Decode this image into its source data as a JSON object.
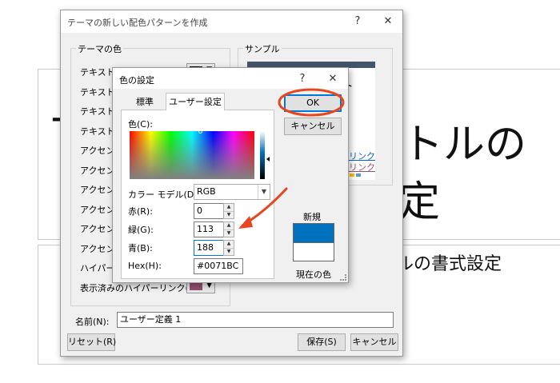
{
  "slide": {
    "title_fragment": "トルの",
    "subtitle_fragment_1": "定",
    "subtitle_fragment_2": "ルの書式設定",
    "left_fragment": "T"
  },
  "main_dialog": {
    "title": "テーマの新しい配色パターンを作成",
    "help": "?",
    "close": "✕",
    "theme_colors_group": "テーマの色",
    "sample_group": "サンプル",
    "rows": [
      {
        "label": "テキスト/背景 - 濃色 1(T)",
        "color": "#000000"
      },
      {
        "label": "テキスト/背景 - 淡色 1(B)",
        "color": "#ffffff"
      },
      {
        "label": "テキスト/背景 - 濃色 2(D)",
        "color": "#44546a"
      },
      {
        "label": "テキスト/背景 - 淡色 2(L)",
        "color": "#e7e6e6"
      },
      {
        "label": "アクセント 1(1)",
        "color": "#4472c4"
      },
      {
        "label": "アクセント 2(2)",
        "color": "#ed7d31"
      },
      {
        "label": "アクセント 3(3)",
        "color": "#a5a5a5"
      },
      {
        "label": "アクセント 4(4)",
        "color": "#ffc000"
      },
      {
        "label": "アクセント 5(5)",
        "color": "#5b9bd5"
      },
      {
        "label": "アクセント 6(6)",
        "color": "#70ad47"
      },
      {
        "label": "ハイパーリンク(H)",
        "color": "#0563c1"
      },
      {
        "label": "表示済みのハイパーリンク(F)",
        "color": "#954f72"
      }
    ],
    "sample_text": "スト",
    "sample_link1": "ーリンク",
    "sample_link2": "ーリンク",
    "name_label": "名前(N):",
    "name_value": "ユーザー定義 1",
    "reset_button": "リセット(R)",
    "save_button": "保存(S)",
    "cancel_button": "キャンセル"
  },
  "color_dialog": {
    "title": "色の設定",
    "help": "?",
    "close": "✕",
    "tab_standard": "標準",
    "tab_custom": "ユーザー設定",
    "ok_button": "OK",
    "cancel_button": "キャンセル",
    "color_label": "色(C):",
    "model_label": "カラー モデル(D):",
    "model_value": "RGB",
    "red_label": "赤(R):",
    "red_value": "0",
    "green_label": "緑(G):",
    "green_value": "113",
    "blue_label": "青(B):",
    "blue_value": "188",
    "hex_label": "Hex(H):",
    "hex_value": "#0071BC",
    "new_label": "新規",
    "current_label": "現在の色",
    "new_color": "#0071BC",
    "current_color": "#ffffff"
  },
  "accent_colors": {
    "annotation": "#e8461e"
  }
}
